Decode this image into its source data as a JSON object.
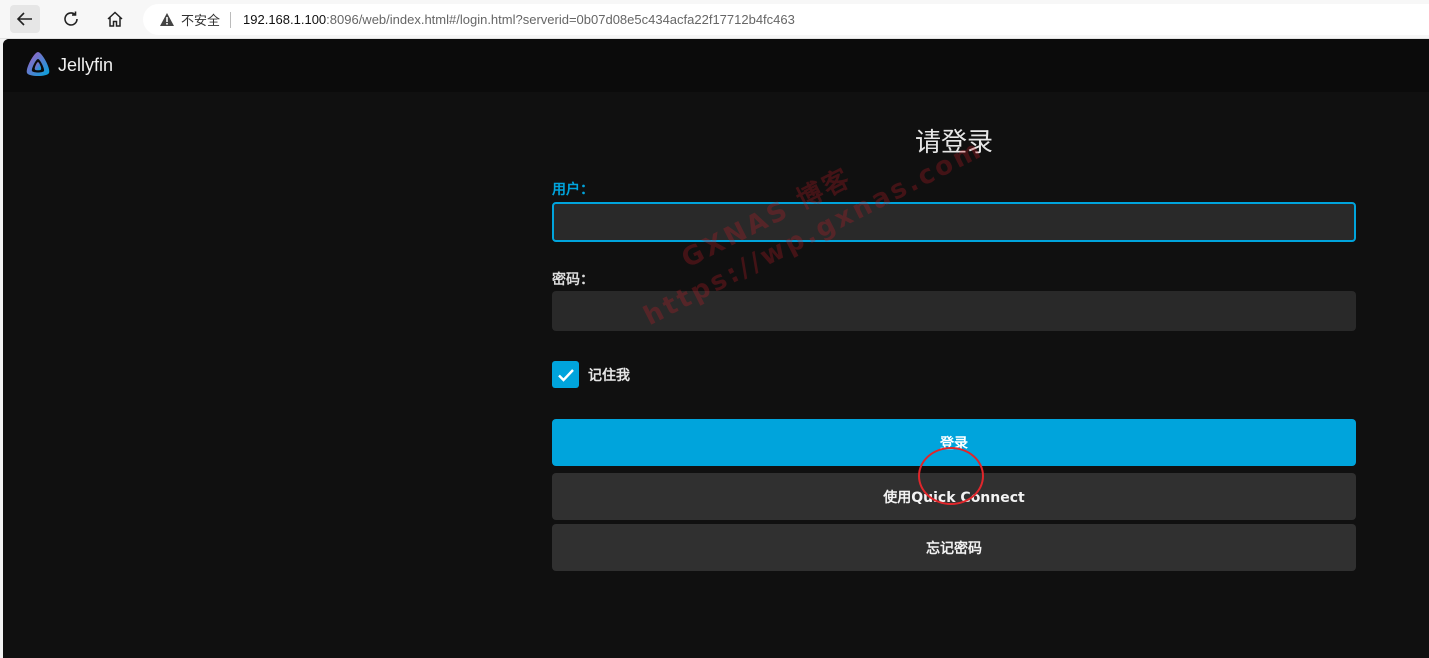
{
  "browser": {
    "security_label": "不安全",
    "url_host": "192.168.1.100",
    "url_rest": ":8096/web/index.html#/login.html?serverid=0b07d08e5c434acfa22f17712b4fc463"
  },
  "app": {
    "logo_text": "Jellyfin",
    "accent_color": "#00a4dc"
  },
  "login": {
    "title": "请登录",
    "username_label": "用户：",
    "username_value": "",
    "password_label": "密码：",
    "password_value": "",
    "remember_label": "记住我",
    "remember_checked": true,
    "submit_label": "登录",
    "quick_connect_label": "使用Quick Connect",
    "forgot_password_label": "忘记密码"
  },
  "watermark": {
    "line1": "GXNAS 博客",
    "line2": "https://wp.gxnas.com"
  }
}
